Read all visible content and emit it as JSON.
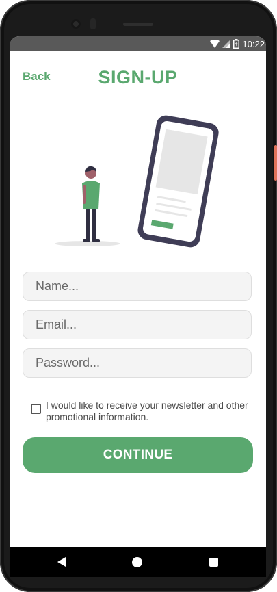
{
  "status_bar": {
    "time": "10:22"
  },
  "header": {
    "back_label": "Back",
    "title": "SIGN-UP"
  },
  "form": {
    "name_placeholder": "Name...",
    "email_placeholder": "Email...",
    "password_placeholder": "Password...",
    "newsletter_label": "I would like to receive your newsletter and other promotional information.",
    "newsletter_checked": false,
    "continue_label": "CONTINUE"
  },
  "colors": {
    "accent": "#5aa86f",
    "field_bg": "#f4f4f4",
    "status_bar": "#595959",
    "phone_frame": "#3f3d56"
  },
  "icons": [
    "wifi-icon",
    "signal-icon",
    "battery-icon",
    "nav-back-icon",
    "nav-home-icon",
    "nav-recents-icon"
  ]
}
